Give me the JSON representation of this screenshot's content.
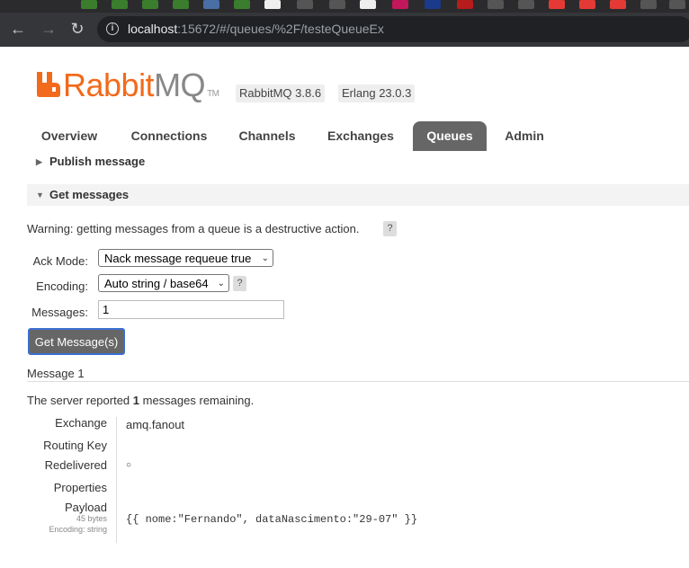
{
  "browser": {
    "url_host": "localhost",
    "url_rest": ":15672/#/queues/%2F/testeQueueEx"
  },
  "header": {
    "logo_rabbit": "Rabbit",
    "logo_mq": "MQ",
    "logo_tm": "TM",
    "version_badge": "RabbitMQ 3.8.6",
    "erlang_badge": "Erlang 23.0.3"
  },
  "tabs": [
    "Overview",
    "Connections",
    "Channels",
    "Exchanges",
    "Queues",
    "Admin"
  ],
  "active_tab": "Queues",
  "publish_section": {
    "title": "Publish message"
  },
  "get_section": {
    "title": "Get messages",
    "warning": "Warning: getting messages from a queue is a destructive action.",
    "help_glyph": "?",
    "ack_mode_label": "Ack Mode:",
    "ack_mode_value": "Nack message requeue true",
    "encoding_label": "Encoding:",
    "encoding_value": "Auto string / base64",
    "messages_label": "Messages:",
    "messages_value": "1",
    "get_button": "Get Message(s)"
  },
  "result": {
    "message_title": "Message 1",
    "server_text_pre": "The server reported ",
    "server_count": "1",
    "server_text_post": " messages remaining.",
    "exchange_label": "Exchange",
    "exchange_value": "amq.fanout",
    "routing_key_label": "Routing Key",
    "routing_key_value": "",
    "redelivered_label": "Redelivered",
    "redelivered_value": "○",
    "properties_label": "Properties",
    "payload_label": "Payload",
    "payload_size": "45 bytes",
    "payload_encoding": "Encoding: string",
    "payload_value": "{{ nome:\"Fernando\", dataNascimento:\"29-07\" }}"
  },
  "colors": {
    "brand_orange": "#f26a1b",
    "tab_active_bg": "#666666",
    "button_border": "#3b6fd1"
  }
}
